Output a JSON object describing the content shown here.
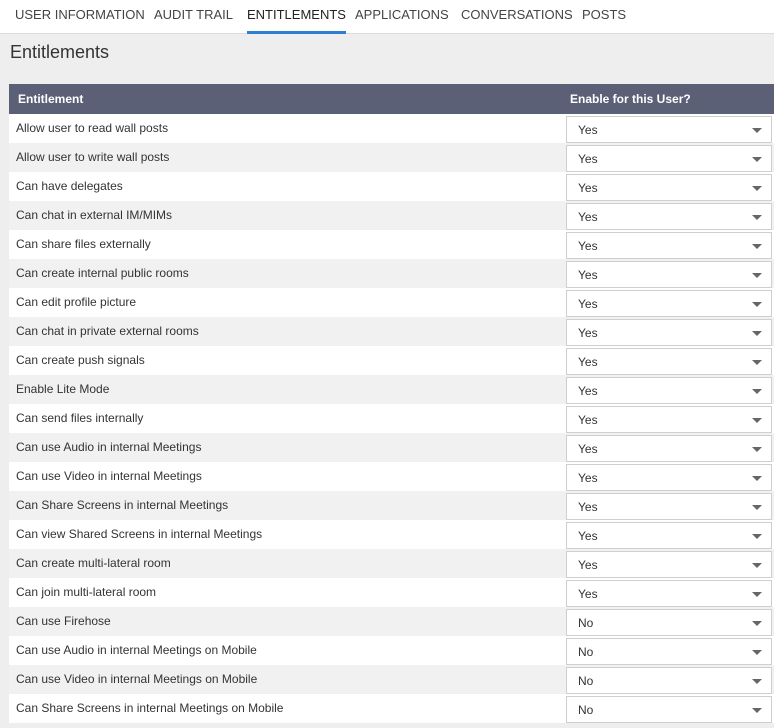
{
  "tabs": [
    {
      "label": "USER INFORMATION",
      "active": false
    },
    {
      "label": "AUDIT TRAIL",
      "active": false
    },
    {
      "label": "ENTITLEMENTS",
      "active": true
    },
    {
      "label": "APPLICATIONS",
      "active": false
    },
    {
      "label": "CONVERSATIONS",
      "active": false
    },
    {
      "label": "POSTS",
      "active": false
    }
  ],
  "page_title": "Entitlements",
  "table": {
    "col_entitlement": "Entitlement",
    "col_enable": "Enable for this User?",
    "rows": [
      {
        "label": "Allow user to read wall posts",
        "value": "Yes"
      },
      {
        "label": "Allow user to write wall posts",
        "value": "Yes"
      },
      {
        "label": "Can have delegates",
        "value": "Yes"
      },
      {
        "label": "Can chat in external IM/MIMs",
        "value": "Yes"
      },
      {
        "label": "Can share files externally",
        "value": "Yes"
      },
      {
        "label": "Can create internal public rooms",
        "value": "Yes"
      },
      {
        "label": "Can edit profile picture",
        "value": "Yes"
      },
      {
        "label": "Can chat in private external rooms",
        "value": "Yes"
      },
      {
        "label": "Can create push signals",
        "value": "Yes"
      },
      {
        "label": "Enable Lite Mode",
        "value": "Yes"
      },
      {
        "label": "Can send files internally",
        "value": "Yes"
      },
      {
        "label": "Can use Audio in internal Meetings",
        "value": "Yes"
      },
      {
        "label": "Can use Video in internal Meetings",
        "value": "Yes"
      },
      {
        "label": "Can Share Screens in internal Meetings",
        "value": "Yes"
      },
      {
        "label": "Can view Shared Screens in internal Meetings",
        "value": "Yes"
      },
      {
        "label": "Can create multi-lateral room",
        "value": "Yes"
      },
      {
        "label": "Can join multi-lateral room",
        "value": "Yes"
      },
      {
        "label": "Can use Firehose",
        "value": "No"
      },
      {
        "label": "Can use Audio in internal Meetings on Mobile",
        "value": "No"
      },
      {
        "label": "Can use Video in internal Meetings on Mobile",
        "value": "No"
      },
      {
        "label": "Can Share Screens in internal Meetings on Mobile",
        "value": "No"
      }
    ]
  },
  "colors": {
    "accent": "#2e7fd3",
    "header_bg": "#5b6076"
  },
  "icons": {
    "dropdown": "chevron-down-icon"
  }
}
